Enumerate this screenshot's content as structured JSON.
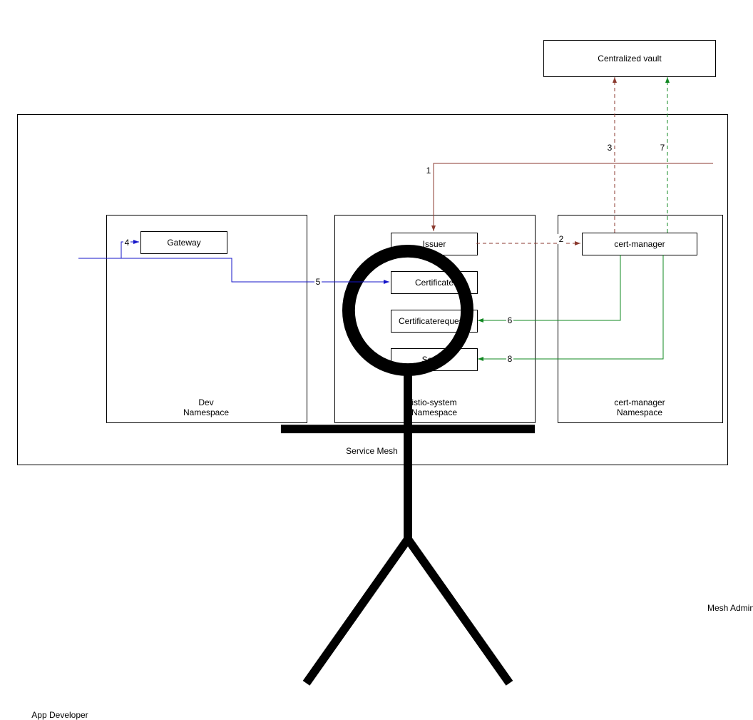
{
  "outer": {
    "vault": "Centralized vault",
    "mesh_admin": "Mesh Admin",
    "app_developer": "App Developer"
  },
  "service_mesh": {
    "title": "Service Mesh",
    "namespaces": {
      "dev": {
        "title_line1": "Dev",
        "title_line2": "Namespace",
        "gateway": "Gateway"
      },
      "istio": {
        "title_line1": "istio-system",
        "title_line2": "Namespace",
        "issuer": "Issuer",
        "certificate": "Certificate",
        "certificaterequests": "Certificaterequests",
        "secret": "Secret"
      },
      "certmanager": {
        "title_line1": "cert-manager",
        "title_line2": "Namespace",
        "certmanager": "cert-manager"
      }
    }
  },
  "edges": {
    "e1": "1",
    "e2": "2",
    "e3": "3",
    "e4": "4",
    "e5": "5",
    "e6": "6",
    "e7": "7",
    "e8": "8"
  }
}
